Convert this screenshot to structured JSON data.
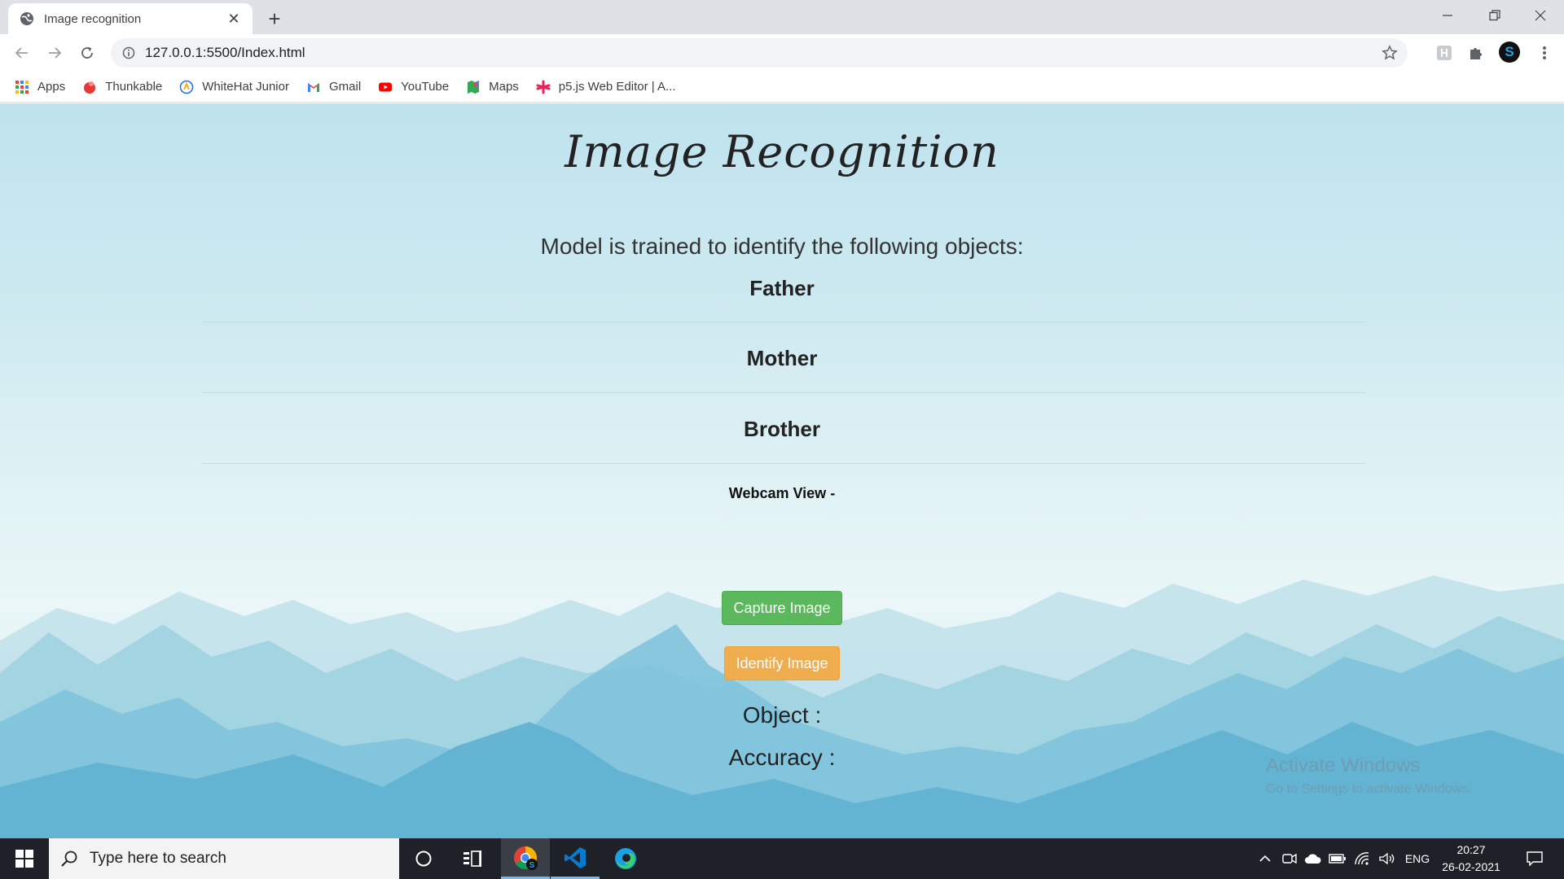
{
  "browser": {
    "tab_title": "Image recognition",
    "url": "127.0.0.1:5500/Index.html",
    "bookmarks": [
      {
        "label": "Apps",
        "icon": "apps-grid-icon"
      },
      {
        "label": "Thunkable",
        "icon": "thunkable-icon"
      },
      {
        "label": "WhiteHat Junior",
        "icon": "whitehat-junior-icon"
      },
      {
        "label": "Gmail",
        "icon": "gmail-icon"
      },
      {
        "label": "YouTube",
        "icon": "youtube-icon"
      },
      {
        "label": "Maps",
        "icon": "maps-icon"
      },
      {
        "label": "p5.js Web Editor | A...",
        "icon": "p5js-icon"
      }
    ],
    "avatar_letter": "S"
  },
  "page": {
    "title": "Image Recognition",
    "intro": "Model is trained to identify the following objects:",
    "objects": [
      "Father",
      "Mother",
      "Brother"
    ],
    "webcam_label": "Webcam View -",
    "capture_button": "Capture Image",
    "identify_button": "Identify Image",
    "object_label": "Object :",
    "accuracy_label": "Accuracy :",
    "watermark_title": "Activate Windows",
    "watermark_sub": "Go to Settings to activate Windows."
  },
  "taskbar": {
    "search_placeholder": "Type here to search",
    "language": "ENG",
    "time": "20:27",
    "date": "26-02-2021"
  },
  "colors": {
    "capture": "#5cb85c",
    "identify": "#f0ad4e",
    "taskbar": "#1e2228"
  }
}
